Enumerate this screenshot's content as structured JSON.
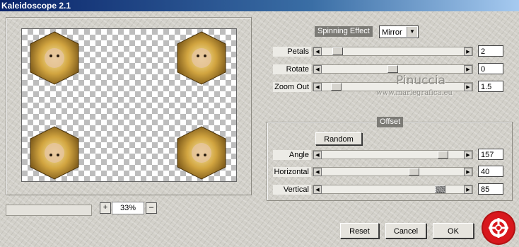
{
  "window": {
    "title": "Kaleidoscope 2.1"
  },
  "preview": {
    "zoom_value": "33%",
    "zoom_in": "+",
    "zoom_out": "–"
  },
  "effect": {
    "label": "Spinning Effect",
    "selected": "Mirror"
  },
  "main_params": [
    {
      "label": "Petals",
      "value": "2",
      "position": 0.08
    },
    {
      "label": "Rotate",
      "value": "0",
      "position": 0.5
    },
    {
      "label": "Zoom Out",
      "value": "1.5",
      "position": 0.07
    }
  ],
  "offset": {
    "title": "Offset",
    "random_label": "Random",
    "params": [
      {
        "label": "Angle",
        "value": "157",
        "position": 0.88
      },
      {
        "label": "Horizontal",
        "value": "40",
        "position": 0.66
      },
      {
        "label": "Vertical",
        "value": "85",
        "position": 0.86
      }
    ]
  },
  "watermark": {
    "name": "Pinuccia",
    "site": "www.mariegrafica.eu"
  },
  "buttons": {
    "reset": "Reset",
    "cancel": "Cancel",
    "ok": "OK"
  },
  "arrows": {
    "left": "◀",
    "right": "▶",
    "down": "▼"
  },
  "colors": {
    "title_start": "#0a246a",
    "title_end": "#a6caf0",
    "logo": "#d8171d",
    "chip": "#7c7b76"
  }
}
